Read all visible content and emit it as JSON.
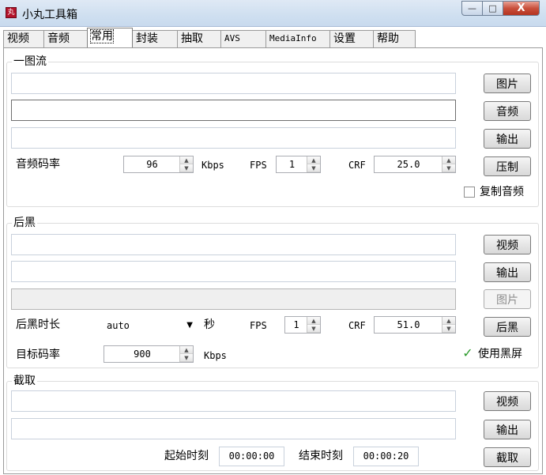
{
  "window": {
    "title": "小丸工具箱",
    "app_icon_glyph": "丸",
    "min_glyph": "—",
    "max_glyph": "□",
    "close_glyph": "X"
  },
  "tabs": [
    "视频",
    "音频",
    "常用",
    "封装",
    "抽取",
    "AVS",
    "MediaInfo",
    "设置",
    "帮助"
  ],
  "active_tab": "常用",
  "spin_arrows": {
    "up": "▲",
    "down": "▼"
  },
  "image_stream": {
    "group_title": "一图流",
    "image_button": "图片",
    "audio_button": "音频",
    "output_button": "输出",
    "bitrate_label": "音频码率",
    "bitrate_value": "96",
    "bitrate_unit": "Kbps",
    "fps_label": "FPS",
    "fps_value": "1",
    "crf_label": "CRF",
    "crf_value": "25.0",
    "encode_button": "压制",
    "copy_audio_label": "复制音频",
    "copy_audio_checked": false
  },
  "black_tail": {
    "group_title": "后黑",
    "video_button": "视频",
    "output_button": "输出",
    "image_button": "图片",
    "duration_label": "后黑时长",
    "duration_value": "auto",
    "duration_unit": "秒",
    "fps_label": "FPS",
    "fps_value": "1",
    "crf_label": "CRF",
    "crf_value": "51.0",
    "run_button": "后黑",
    "target_bitrate_label": "目标码率",
    "target_bitrate_value": "900",
    "target_bitrate_unit": "Kbps",
    "use_black_label": "使用黑屏",
    "use_black_checked": true,
    "check_glyph": "✓"
  },
  "clip": {
    "group_title": "截取",
    "video_button": "视频",
    "output_button": "输出",
    "start_label": "起始时刻",
    "start_value": "00:00:00",
    "end_label": "结束时刻",
    "end_value": "00:00:20",
    "run_button": "截取"
  }
}
